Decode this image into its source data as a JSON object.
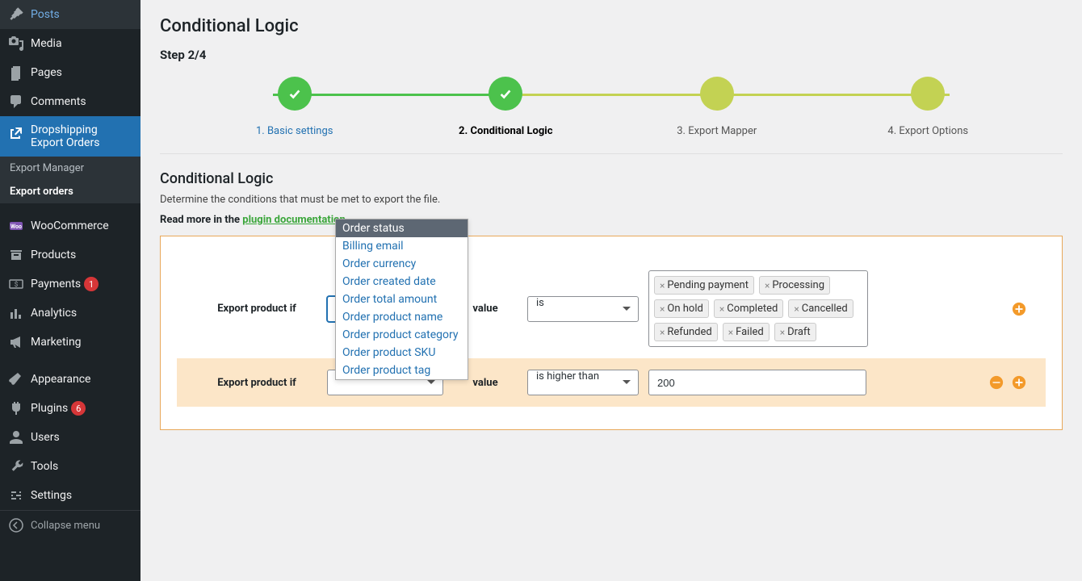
{
  "sidebar": {
    "items": [
      {
        "label": "Posts"
      },
      {
        "label": "Media"
      },
      {
        "label": "Pages"
      },
      {
        "label": "Comments"
      },
      {
        "label": "Dropshipping Export Orders",
        "current": true
      },
      {
        "label": "WooCommerce"
      },
      {
        "label": "Products"
      },
      {
        "label": "Payments",
        "count": "1"
      },
      {
        "label": "Analytics"
      },
      {
        "label": "Marketing"
      },
      {
        "label": "Appearance"
      },
      {
        "label": "Plugins",
        "count": "6"
      },
      {
        "label": "Users"
      },
      {
        "label": "Tools"
      },
      {
        "label": "Settings"
      }
    ],
    "sub": [
      {
        "label": "Export Manager"
      },
      {
        "label": "Export orders",
        "current": true
      }
    ],
    "collapse": "Collapse menu"
  },
  "page": {
    "title": "Conditional Logic",
    "step_label": "Step 2/4",
    "steps": [
      {
        "name": "1. Basic settings"
      },
      {
        "name": "2. Conditional Logic"
      },
      {
        "name": "3. Export Mapper"
      },
      {
        "name": "4. Export Options"
      }
    ],
    "section_title": "Conditional Logic",
    "desc": "Determine the conditions that must be met to export the file.",
    "readmore_prefix": "Read more in the ",
    "readmore_link": "plugin documentation"
  },
  "conditions": {
    "label": "Export product if",
    "value_label": "value",
    "row1": {
      "field": "Order status",
      "operator": "is",
      "tags": [
        "Pending payment",
        "Processing",
        "On hold",
        "Completed",
        "Cancelled",
        "Refunded",
        "Failed",
        "Draft"
      ]
    },
    "row2": {
      "field": "Order total amount",
      "operator": "is higher than",
      "value": "200"
    }
  },
  "dropdown": {
    "options": [
      "Order status",
      "Billing email",
      "Order currency",
      "Order created date",
      "Order total amount",
      "Order product name",
      "Order product category",
      "Order product SKU",
      "Order product tag"
    ]
  }
}
